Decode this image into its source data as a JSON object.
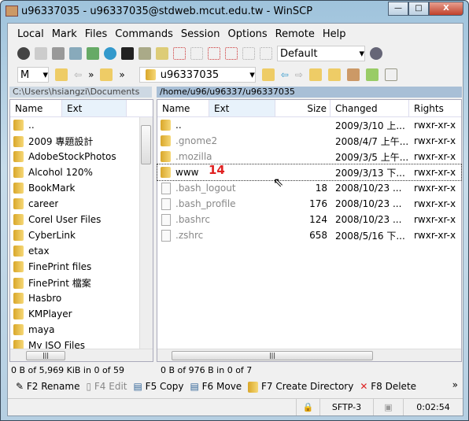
{
  "window": {
    "title": "u96337035 - u96337035@stdweb.mcut.edu.tw - WinSCP",
    "minimize": "—",
    "maximize": "□",
    "close": "X"
  },
  "menu": [
    "Local",
    "Mark",
    "Files",
    "Commands",
    "Session",
    "Options",
    "Remote",
    "Help"
  ],
  "toolbar": {
    "transfer_settings": "Default"
  },
  "left": {
    "drive": "M",
    "path": "C:\\Users\\hsiangzi\\Documents",
    "columns": [
      "Name",
      "Ext"
    ],
    "items": [
      "..",
      "2009 專題設計",
      "AdobeStockPhotos",
      "Alcohol 120%",
      "BookMark",
      "career",
      "Corel User Files",
      "CyberLink",
      "etax",
      "FinePrint files",
      "FinePrint 檔案",
      "Hasbro",
      "KMPlayer",
      "maya",
      "My ISO Files"
    ],
    "status": "0 B of 5,969 KiB in 0 of 59"
  },
  "right": {
    "dir": "u96337035",
    "path": "/home/u96/u96337/u96337035",
    "columns": [
      "Name",
      "Ext",
      "Size",
      "Changed",
      "Rights"
    ],
    "items": [
      {
        "name": "..",
        "size": "",
        "changed": "2009/3/10 上...",
        "rights": "rwxr-xr-x",
        "type": "up"
      },
      {
        "name": ".gnome2",
        "size": "",
        "changed": "2008/4/7 上午...",
        "rights": "rwxr-xr-x",
        "type": "folder"
      },
      {
        "name": ".mozilla",
        "size": "",
        "changed": "2009/3/5 上午...",
        "rights": "rwxr-xr-x",
        "type": "folder"
      },
      {
        "name": "www",
        "size": "",
        "changed": "2009/3/13 下...",
        "rights": "rwxr-xr-x",
        "type": "folder"
      },
      {
        "name": ".bash_logout",
        "size": "18",
        "changed": "2008/10/23 ...",
        "rights": "rwxr-xr-x",
        "type": "file"
      },
      {
        "name": ".bash_profile",
        "size": "176",
        "changed": "2008/10/23 ...",
        "rights": "rwxr-xr-x",
        "type": "file"
      },
      {
        "name": ".bashrc",
        "size": "124",
        "changed": "2008/10/23 ...",
        "rights": "rwxr-xr-x",
        "type": "file"
      },
      {
        "name": ".zshrc",
        "size": "658",
        "changed": "2008/5/16 下...",
        "rights": "rwxr-xr-x",
        "type": "file"
      }
    ],
    "status": "0 B of 976 B in 0 of 7"
  },
  "annotation": "14",
  "commands": [
    "F2 Rename",
    "F4 Edit",
    "F5 Copy",
    "F6 Move",
    "F7 Create Directory",
    "F8 Delete"
  ],
  "statusbar": {
    "protocol": "SFTP-3",
    "elapsed": "0:02:54"
  }
}
